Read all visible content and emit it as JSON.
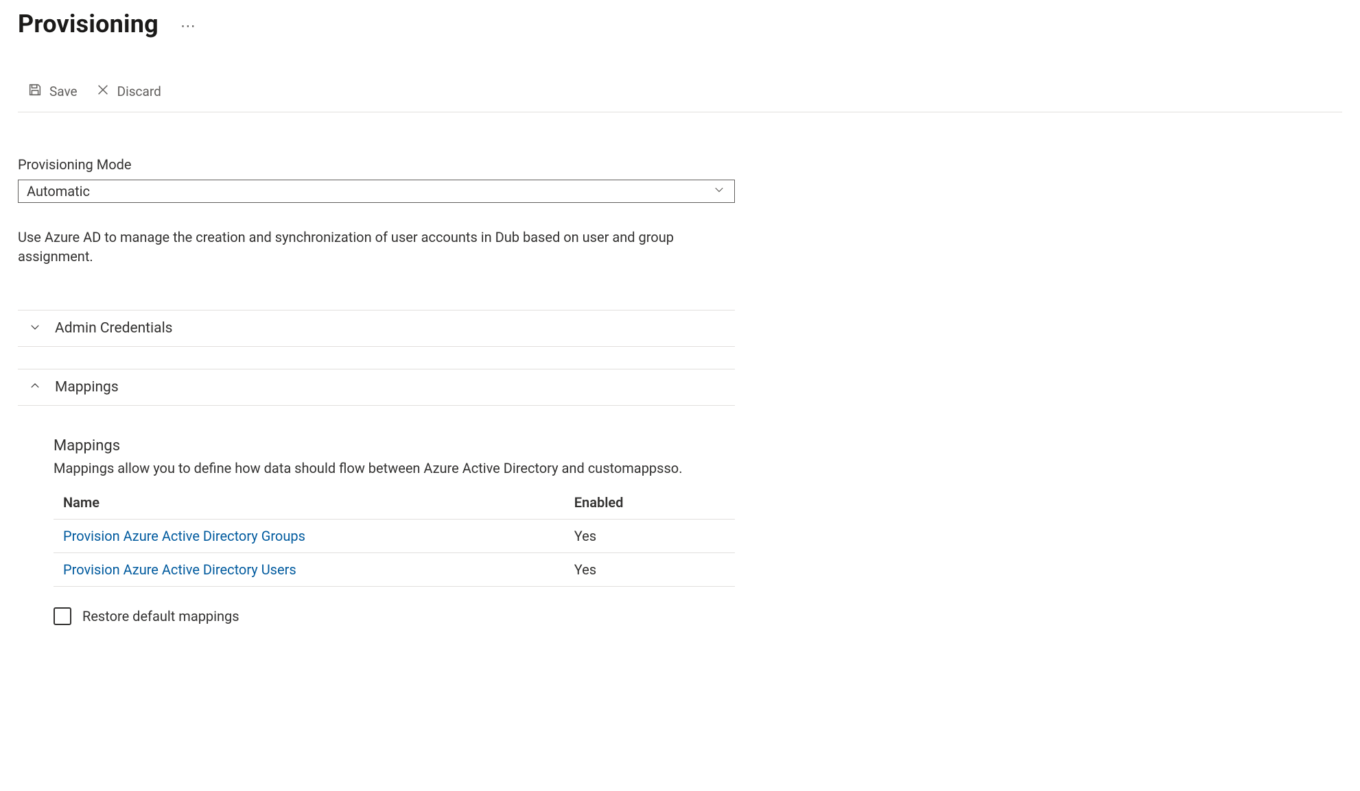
{
  "header": {
    "title": "Provisioning"
  },
  "toolbar": {
    "save_label": "Save",
    "discard_label": "Discard"
  },
  "provisioning_mode": {
    "label": "Provisioning Mode",
    "value": "Automatic",
    "description": "Use Azure AD to manage the creation and synchronization of user accounts in Dub based on user and group assignment."
  },
  "sections": {
    "admin_credentials": {
      "title": "Admin Credentials",
      "expanded": false
    },
    "mappings": {
      "title": "Mappings",
      "expanded": true,
      "sub_title": "Mappings",
      "sub_desc": "Mappings allow you to define how data should flow between Azure Active Directory and customappsso.",
      "columns": {
        "name": "Name",
        "enabled": "Enabled"
      },
      "rows": [
        {
          "name": "Provision Azure Active Directory Groups",
          "enabled": "Yes"
        },
        {
          "name": "Provision Azure Active Directory Users",
          "enabled": "Yes"
        }
      ],
      "restore_label": "Restore default mappings"
    }
  }
}
